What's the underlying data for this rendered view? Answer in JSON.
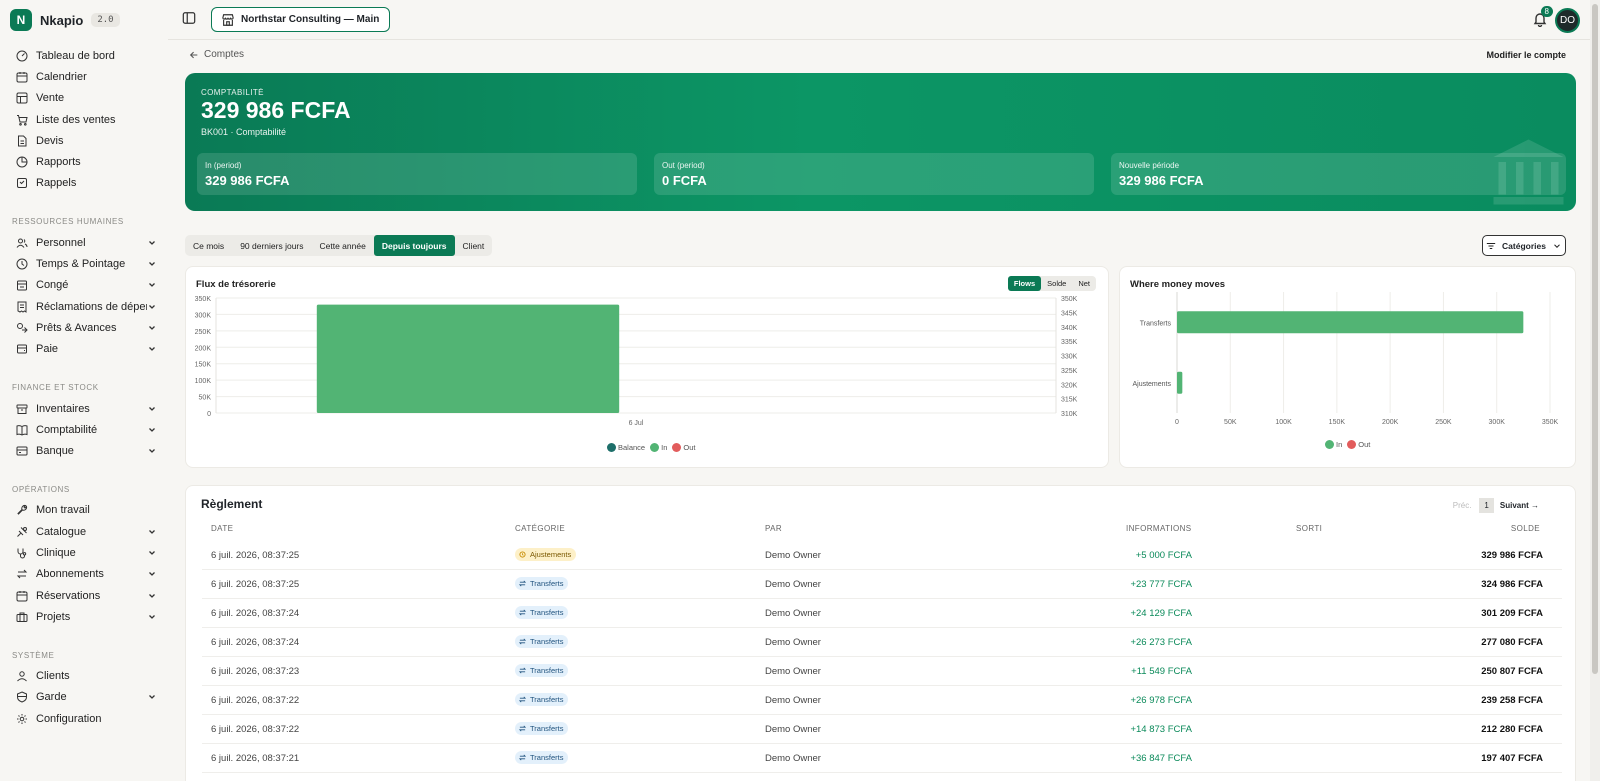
{
  "brand": {
    "initial": "N",
    "name": "Nkapio",
    "version": "2.0"
  },
  "nav_main": [
    {
      "icon": "dashboard-icon",
      "label": "Tableau de bord"
    },
    {
      "icon": "calendar-icon",
      "label": "Calendrier"
    },
    {
      "icon": "sale-icon",
      "label": "Vente"
    },
    {
      "icon": "cart-icon",
      "label": "Liste des ventes"
    },
    {
      "icon": "document-icon",
      "label": "Devis"
    },
    {
      "icon": "report-icon",
      "label": "Rapports"
    },
    {
      "icon": "reminder-icon",
      "label": "Rappels"
    }
  ],
  "sections": [
    {
      "title": "RESSOURCES HUMAINES",
      "items": [
        {
          "icon": "users-icon",
          "label": "Personnel",
          "chevron": true
        },
        {
          "icon": "clock-icon",
          "label": "Temps & Pointage",
          "chevron": true
        },
        {
          "icon": "leave-icon",
          "label": "Congé",
          "chevron": true
        },
        {
          "icon": "receipt-icon",
          "label": "Réclamations de dépenses",
          "chevron": true
        },
        {
          "icon": "loan-icon",
          "label": "Prêts & Avances",
          "chevron": true
        },
        {
          "icon": "payroll-icon",
          "label": "Paie",
          "chevron": true
        }
      ]
    },
    {
      "title": "FINANCE ET STOCK",
      "items": [
        {
          "icon": "inventory-icon",
          "label": "Inventaires",
          "chevron": true
        },
        {
          "icon": "book-icon",
          "label": "Comptabilité",
          "chevron": true
        },
        {
          "icon": "bank-icon",
          "label": "Banque",
          "chevron": true
        }
      ]
    },
    {
      "title": "OPÉRATIONS",
      "items": [
        {
          "icon": "wrench-icon",
          "label": "Mon travail",
          "chevron": false
        },
        {
          "icon": "catalog-icon",
          "label": "Catalogue",
          "chevron": true
        },
        {
          "icon": "stethoscope-icon",
          "label": "Clinique",
          "chevron": true
        },
        {
          "icon": "repeat-icon",
          "label": "Abonnements",
          "chevron": true
        },
        {
          "icon": "calendar-icon",
          "label": "Réservations",
          "chevron": true
        },
        {
          "icon": "briefcase-icon",
          "label": "Projets",
          "chevron": true
        }
      ]
    },
    {
      "title": "SYSTÈME",
      "items": [
        {
          "icon": "user-icon",
          "label": "Clients",
          "chevron": false
        },
        {
          "icon": "shield-icon",
          "label": "Garde",
          "chevron": true
        },
        {
          "icon": "gear-icon",
          "label": "Configuration",
          "chevron": false
        }
      ]
    }
  ],
  "topbar": {
    "org": "Northstar Consulting — Main",
    "notifications": "8",
    "avatar": "DO"
  },
  "breadcrumb": "Comptes",
  "edit_account": "Modifier le compte",
  "hero": {
    "label": "COMPTABILITÉ",
    "amount": "329 986 FCFA",
    "sub": "BK001 · Comptabilité",
    "stats": [
      {
        "label": "In (period)",
        "value": "329 986 FCFA"
      },
      {
        "label": "Out (period)",
        "value": "0 FCFA"
      },
      {
        "label": "Nouvelle période",
        "value": "329 986 FCFA"
      }
    ]
  },
  "period_tabs": [
    "Ce mois",
    "90 derniers jours",
    "Cette année",
    "Depuis toujours",
    "Client"
  ],
  "active_tab": 3,
  "categories_button": "Catégories",
  "cashflow": {
    "title": "Flux de trésorerie",
    "modes": [
      "Flows",
      "Solde",
      "Net"
    ],
    "active_mode": 0,
    "legend": [
      "Balance",
      "In",
      "Out"
    ]
  },
  "money_moves": {
    "title": "Where money moves",
    "legend": [
      "In",
      "Out"
    ]
  },
  "colors": {
    "accent": "#0b7a55",
    "in": "#52b474",
    "out": "#e25c5c",
    "balance": "#1e6f6a"
  },
  "chart_data": [
    {
      "type": "bar",
      "title": "Flux de trésorerie",
      "categories": [
        "6 Jul"
      ],
      "series": [
        {
          "name": "In",
          "values": [
            329986
          ]
        },
        {
          "name": "Out",
          "values": [
            0
          ]
        }
      ],
      "y_left_ticks": [
        "350K",
        "300K",
        "250K",
        "200K",
        "150K",
        "100K",
        "50K",
        "0"
      ],
      "y_right_ticks": [
        "350K",
        "345K",
        "340K",
        "335K",
        "330K",
        "325K",
        "320K",
        "315K",
        "310K"
      ],
      "ylim": [
        0,
        350000
      ],
      "y_right_lim": [
        310000,
        350000
      ],
      "legend_position": "bottom"
    },
    {
      "type": "bar",
      "orientation": "horizontal",
      "title": "Where money moves",
      "categories": [
        "Transferts",
        "Ajustements"
      ],
      "series": [
        {
          "name": "In",
          "values": [
            324986,
            5000
          ]
        },
        {
          "name": "Out",
          "values": [
            0,
            0
          ]
        }
      ],
      "x_ticks": [
        "0",
        "50K",
        "100K",
        "150K",
        "200K",
        "250K",
        "300K",
        "350K"
      ],
      "xlim": [
        0,
        350000
      ],
      "legend_position": "bottom"
    }
  ],
  "table": {
    "title": "Règlement",
    "pager": {
      "prev": "Préc.",
      "page": "1",
      "next": "Suivant →"
    },
    "headers": [
      "DATE",
      "CATÉGORIE",
      "PAR",
      "INFORMATIONS",
      "SORTI",
      "SOLDE"
    ],
    "rows": [
      {
        "date": "6 juil. 2026, 08:37:25",
        "category": "Ajustements",
        "kind": "adj",
        "by": "Demo Owner",
        "info": "+5 000 FCFA",
        "out": "",
        "balance": "329 986 FCFA"
      },
      {
        "date": "6 juil. 2026, 08:37:25",
        "category": "Transferts",
        "kind": "trf",
        "by": "Demo Owner",
        "info": "+23 777 FCFA",
        "out": "",
        "balance": "324 986 FCFA"
      },
      {
        "date": "6 juil. 2026, 08:37:24",
        "category": "Transferts",
        "kind": "trf",
        "by": "Demo Owner",
        "info": "+24 129 FCFA",
        "out": "",
        "balance": "301 209 FCFA"
      },
      {
        "date": "6 juil. 2026, 08:37:24",
        "category": "Transferts",
        "kind": "trf",
        "by": "Demo Owner",
        "info": "+26 273 FCFA",
        "out": "",
        "balance": "277 080 FCFA"
      },
      {
        "date": "6 juil. 2026, 08:37:23",
        "category": "Transferts",
        "kind": "trf",
        "by": "Demo Owner",
        "info": "+11 549 FCFA",
        "out": "",
        "balance": "250 807 FCFA"
      },
      {
        "date": "6 juil. 2026, 08:37:22",
        "category": "Transferts",
        "kind": "trf",
        "by": "Demo Owner",
        "info": "+26 978 FCFA",
        "out": "",
        "balance": "239 258 FCFA"
      },
      {
        "date": "6 juil. 2026, 08:37:22",
        "category": "Transferts",
        "kind": "trf",
        "by": "Demo Owner",
        "info": "+14 873 FCFA",
        "out": "",
        "balance": "212 280 FCFA"
      },
      {
        "date": "6 juil. 2026, 08:37:21",
        "category": "Transferts",
        "kind": "trf",
        "by": "Demo Owner",
        "info": "+36 847 FCFA",
        "out": "",
        "balance": "197 407 FCFA"
      }
    ]
  }
}
